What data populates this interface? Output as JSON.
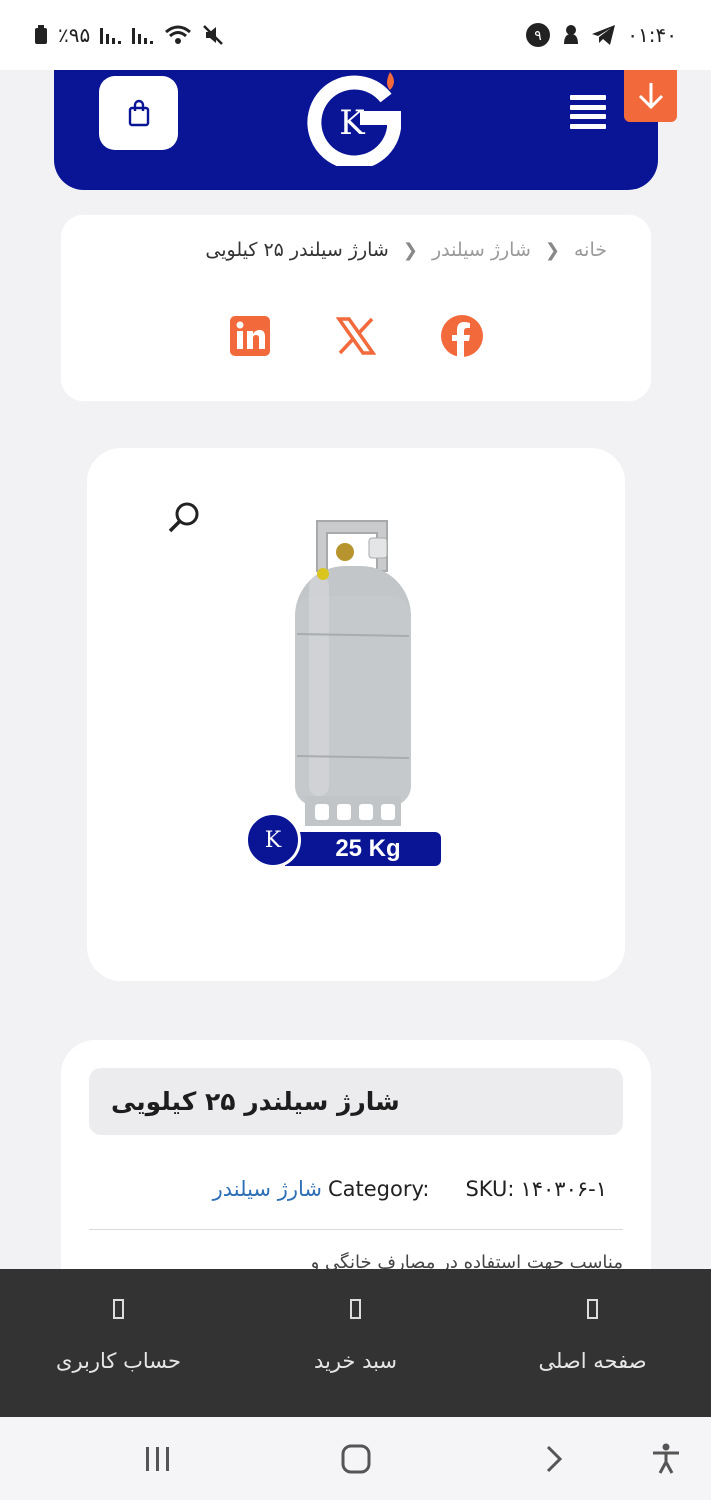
{
  "status_bar": {
    "battery": "٪۹۵",
    "time": "۰۱:۴۰",
    "notification_badge": "۹",
    "icons": [
      "battery-icon",
      "signal-icon",
      "signal-icon",
      "wifi-icon",
      "mute-icon",
      "notification-badge-icon",
      "ghost-icon",
      "telegram-icon"
    ]
  },
  "header": {
    "logo_text": "K",
    "brand_color": "#0a1596",
    "accent_color": "#f26a3c",
    "icons": [
      "shopping-bag-icon",
      "menu-icon",
      "arrow-down-icon"
    ]
  },
  "breadcrumb": {
    "items": [
      "خانه",
      "شارژ سیلندر"
    ],
    "current": "شارژ سیلندر ۲۵ کیلویی",
    "separator_icon": "chevron-left-icon"
  },
  "share": {
    "icons": [
      "linkedin-icon",
      "x-twitter-icon",
      "facebook-icon"
    ],
    "color": "#f26a3c"
  },
  "product_image": {
    "badge_text": "25 Kg",
    "badge_logo": "K",
    "icons": [
      "search-zoom-icon"
    ]
  },
  "product": {
    "title": "شارژ سیلندر ۲۵ کیلویی",
    "sku_label": "SKU:",
    "sku_value": "۱۴۰۳۰۶-۱",
    "category_label": "Category:",
    "category_value": "شارژ سیلندر",
    "description_peek": "مناسب جهت استفاده در مصارف خانگی و"
  },
  "bottom_nav": {
    "items": [
      {
        "label": "حساب کاربری"
      },
      {
        "label": "سبد خرید"
      },
      {
        "label": "صفحه اصلی"
      }
    ]
  },
  "system_nav": {
    "icons": [
      "recent-apps-icon",
      "home-icon",
      "back-icon",
      "accessibility-icon"
    ]
  }
}
